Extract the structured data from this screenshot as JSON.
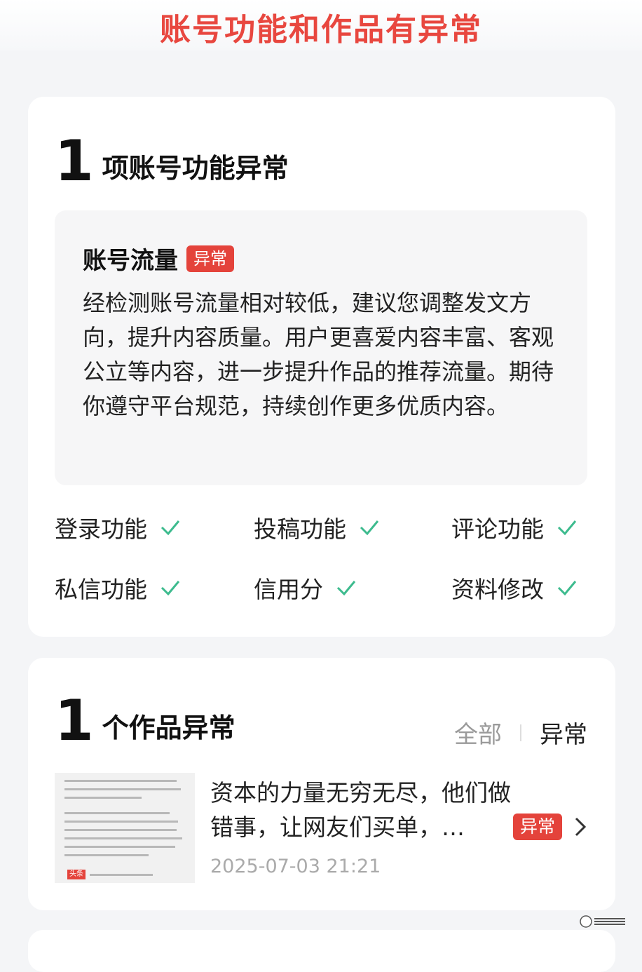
{
  "header": {
    "title": "账号功能和作品有异常"
  },
  "account_section": {
    "count": "1",
    "title": "项账号功能异常",
    "notice": {
      "title": "账号流量",
      "badge": "异常",
      "body": "经检测账号流量相对较低，建议您调整发文方向，提升内容质量。用户更喜爱内容丰富、客观公立等内容，进一步提升作品的推荐流量。期待你遵守平台规范，持续创作更多优质内容。"
    },
    "functions": [
      {
        "label": "登录功能",
        "status": "ok"
      },
      {
        "label": "投稿功能",
        "status": "ok"
      },
      {
        "label": "评论功能",
        "status": "ok"
      },
      {
        "label": "私信功能",
        "status": "ok"
      },
      {
        "label": "信用分",
        "status": "ok"
      },
      {
        "label": "资料修改",
        "status": "ok"
      }
    ]
  },
  "works_section": {
    "count": "1",
    "title": "个作品异常",
    "tabs": {
      "all": "全部",
      "abnormal": "异常"
    },
    "works": [
      {
        "title": "资本的力量无穷无尽，他们做错事，让网友们买单，…",
        "date": "2025-07-03 21:21",
        "badge": "异常",
        "thumb_logo": "头条"
      }
    ]
  },
  "colors": {
    "accent": "#e8473f",
    "badge": "#e4433b",
    "check": "#3dbb8e"
  },
  "icons": {
    "check": "check-icon",
    "chevron": "chevron-right-icon"
  }
}
